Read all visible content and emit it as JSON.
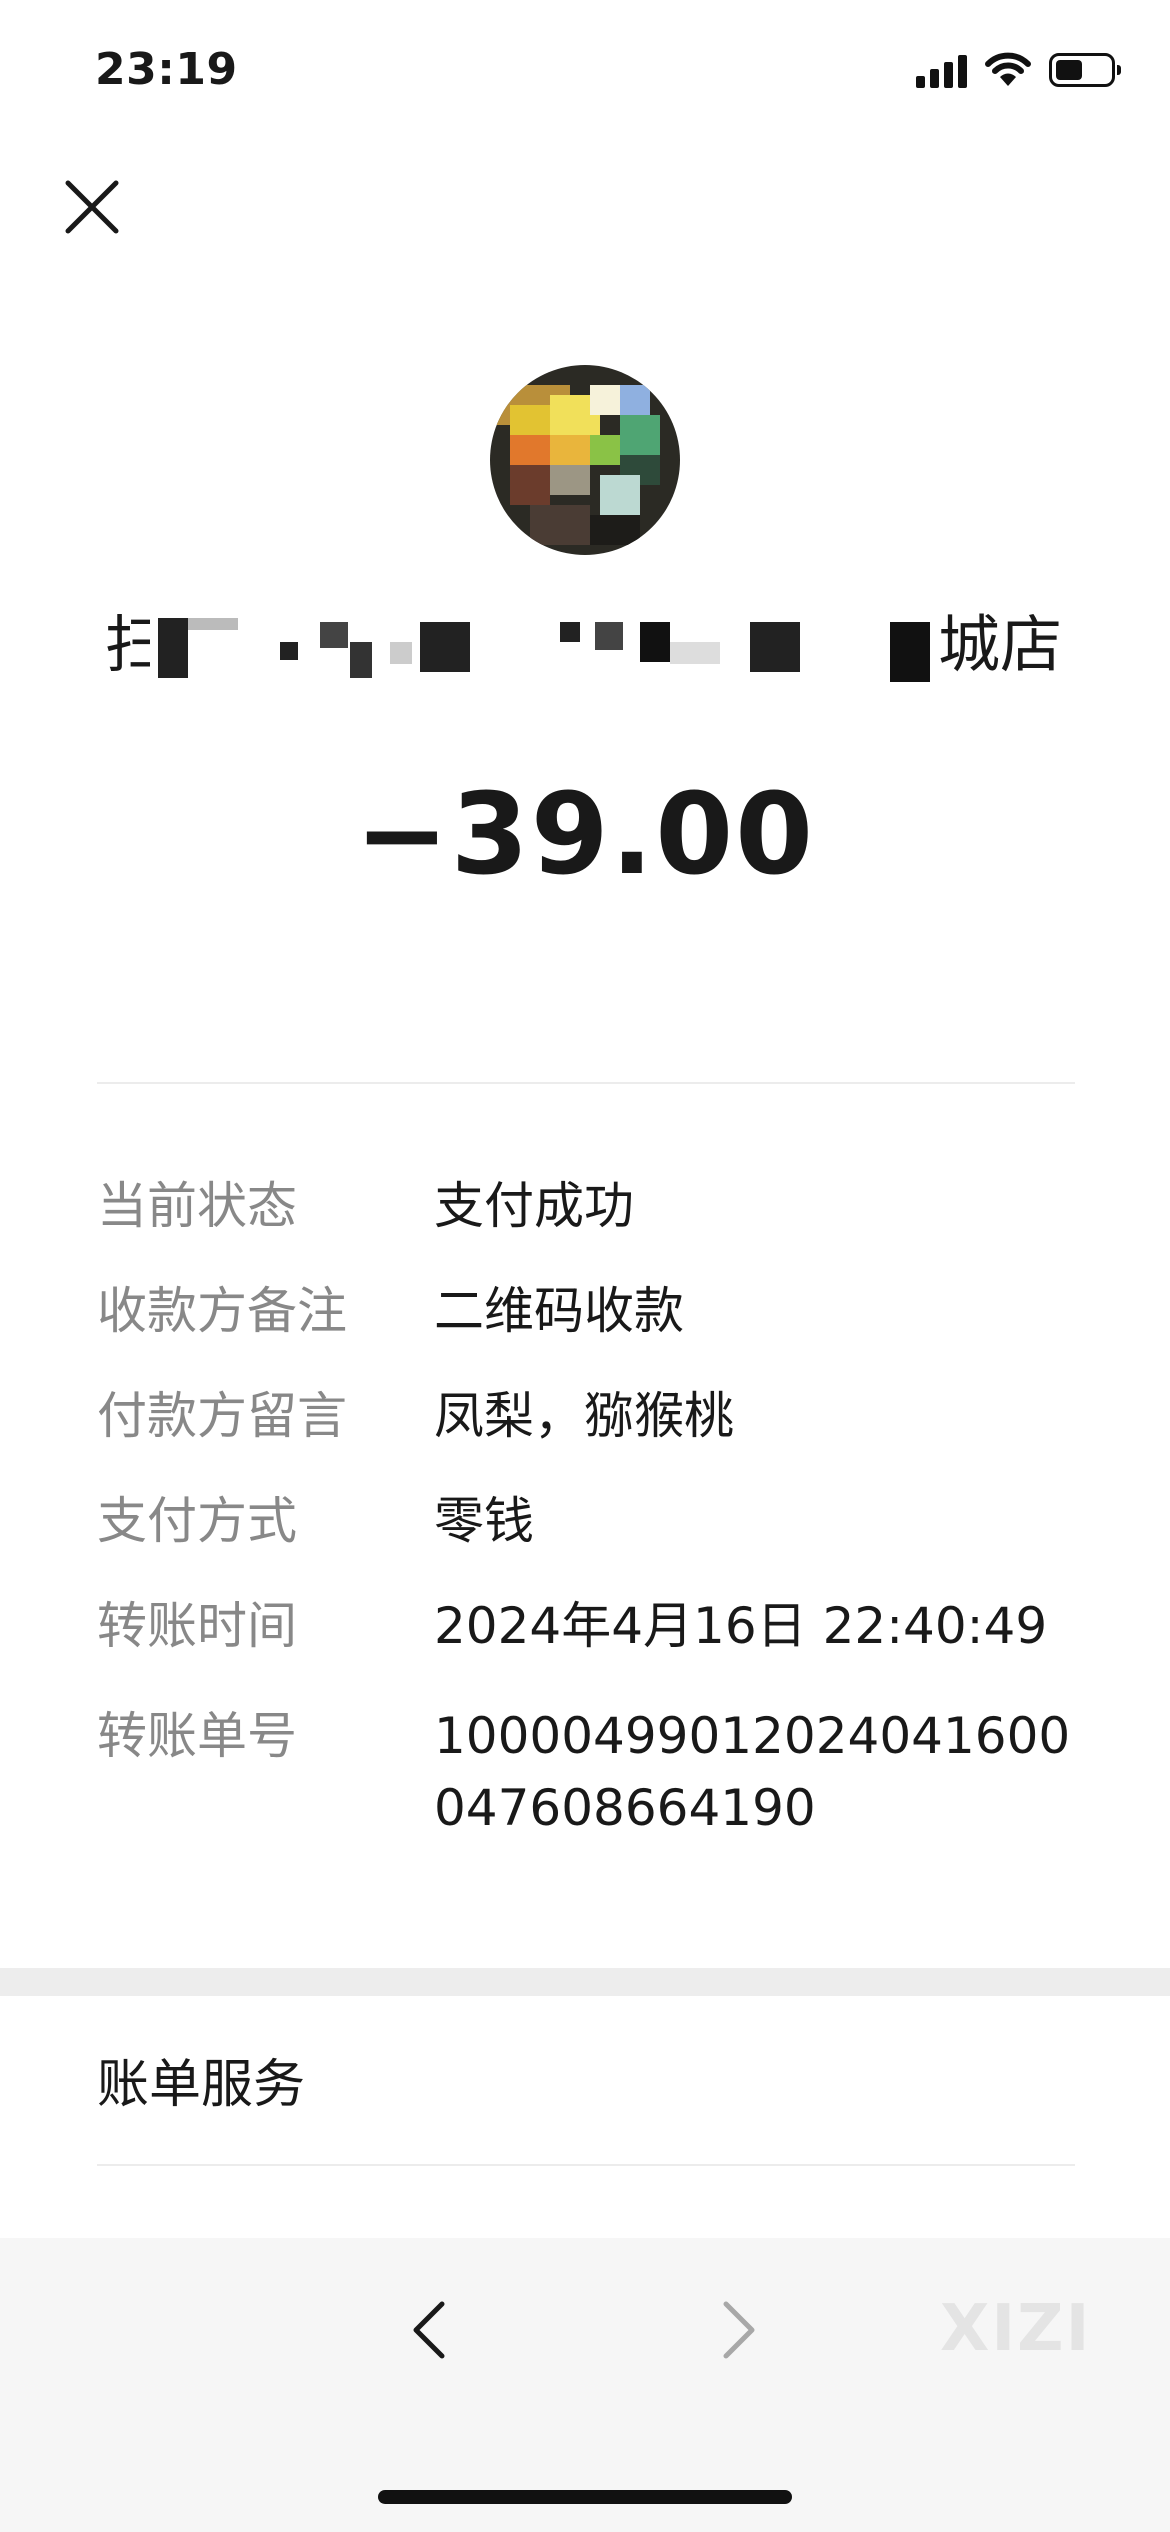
{
  "status_bar": {
    "time": "23:19"
  },
  "header": {
    "close_icon": "close-icon"
  },
  "merchant": {
    "name_start": "扫",
    "name_end": "城店",
    "avatar": "merchant-avatar-pixelated"
  },
  "amount": "−39.00",
  "details": [
    {
      "label": "当前状态",
      "value": "支付成功"
    },
    {
      "label": "收款方备注",
      "value": "二维码收款"
    },
    {
      "label": "付款方留言",
      "value": "凤梨，猕猴桃"
    },
    {
      "label": "支付方式",
      "value": "零钱"
    },
    {
      "label": "转账时间",
      "value": "2024年4月16日 22:40:49"
    },
    {
      "label": "转账单号",
      "value": "100004990120240416000476086641​90"
    }
  ],
  "bill_service": {
    "label": "账单服务"
  },
  "toolbar": {
    "back_icon": "chevron-left-icon",
    "forward_icon": "chevron-right-icon",
    "watermark": "XIZI"
  },
  "colors": {
    "text": "#191919",
    "label": "#888888",
    "divider": "#ececec",
    "toolbar_bg": "#f6f6f6"
  }
}
